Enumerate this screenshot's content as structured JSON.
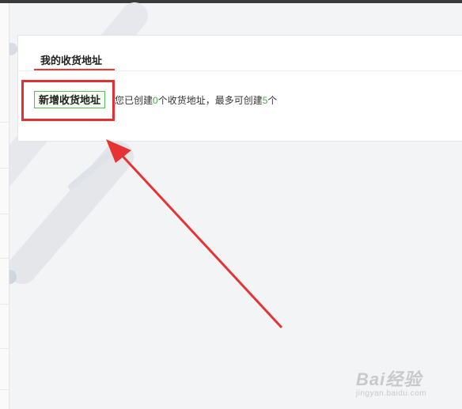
{
  "address_card": {
    "tab_label": "我的收货地址",
    "add_button_label": "新增收货地址",
    "info": {
      "prefix": "您已创建",
      "created_count": "0",
      "middle": "个收货地址，最多可创建",
      "max_count": "5",
      "suffix": "个"
    }
  },
  "watermark": {
    "main": "Bai经验",
    "sub": "jingyan.baidu.com"
  },
  "colors": {
    "highlight": "#e03030",
    "accent_green": "#49a84a",
    "tab_underline": "#e23a3a"
  }
}
